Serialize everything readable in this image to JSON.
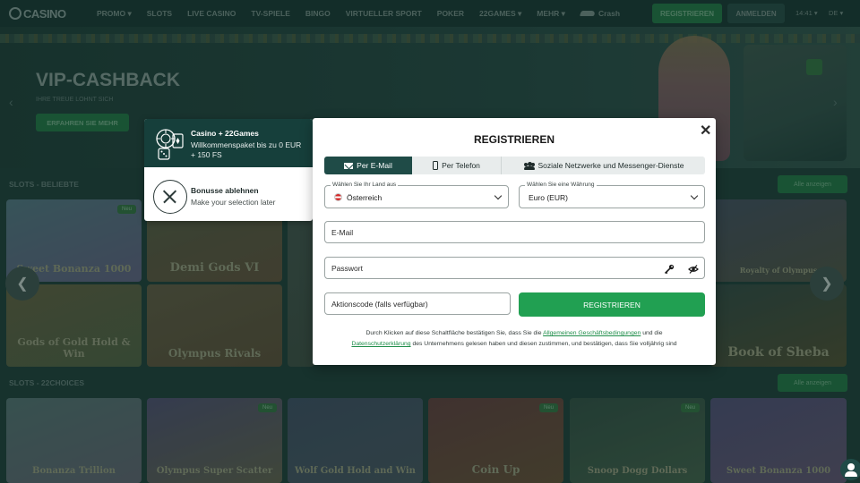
{
  "header": {
    "logo_text": "CASINO",
    "nav": [
      "PROMO",
      "SLOTS",
      "LIVE CASINO",
      "TV-SPIELE",
      "BINGO",
      "VIRTUELLER SPORT",
      "POKER",
      "22GAMES",
      "MEHR"
    ],
    "crash_label": "Crash",
    "register_label": "REGISTRIEREN",
    "login_label": "ANMELDEN",
    "time": "14:41",
    "lang": "DE"
  },
  "hero": {
    "title": "VIP-CASHBACK",
    "subtitle": "IHRE TREUE LOHNT SICH",
    "cta": "ERFAHREN SIE MEHR"
  },
  "sections": [
    {
      "title": "SLOTS - BELIEBTE",
      "show_all": "Alle anzeigen",
      "tiles": [
        "Sweet Bonanza 1000",
        "Demi Gods VI",
        "Gods of Gold Hold & Win",
        "Olympus Rivals",
        "Royalty of Olympus",
        "Book of Sheba"
      ],
      "new_badge": "Neu"
    },
    {
      "title": "SLOTS - 22CHOICES",
      "show_all": "Alle anzeigen",
      "tiles": [
        "Bonanza Trillion",
        "Olympus Super Scatter",
        "Wolf Gold Hold and Win",
        "Coin Up",
        "Snoop Dogg Dollars",
        "Sweet Bonanza 1000"
      ],
      "new_badge": "Neu"
    }
  ],
  "bonus": {
    "title": "Casino + 22Games",
    "description": "Willkommenspaket bis zu 0 EUR + 150 FS",
    "decline_title": "Bonusse ablehnen",
    "decline_sub": "Make your selection later"
  },
  "modal": {
    "title": "REGISTRIEREN",
    "tabs": [
      "Per E-Mail",
      "Per Telefon",
      "Soziale Netzwerke und Messenger-Dienste"
    ],
    "country": {
      "label": "Wählen Sie Ihr Land aus",
      "value": "Österreich"
    },
    "currency": {
      "label": "Wählen Sie eine Währung",
      "value": "Euro (EUR)"
    },
    "email_placeholder": "E-Mail",
    "password_placeholder": "Passwort",
    "promo_placeholder": "Aktionscode (falls verfügbar)",
    "submit_label": "REGISTRIEREN",
    "terms": {
      "part1": "Durch Klicken auf diese Schaltfläche bestätigen Sie, dass Sie die ",
      "link1": "Allgemeinen Geschäftsbedingungen",
      "part2": " und die ",
      "link2": "Datenschutzerklärung",
      "part3": " des Unternehmens gelesen haben und diesen zustimmen, und bestätigen, dass Sie volljährig sind"
    }
  },
  "colors": {
    "accent_green": "#21a052",
    "tab_active": "#1f4b47",
    "page_bg": "#1d3b36"
  }
}
